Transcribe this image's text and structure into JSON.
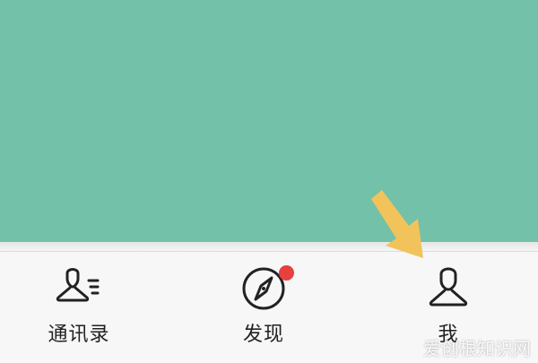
{
  "content": {
    "background_color": "#73c1a9"
  },
  "tabbar": {
    "tabs": [
      {
        "label": "通讯录",
        "icon": "contacts-icon"
      },
      {
        "label": "发现",
        "icon": "compass-icon",
        "has_badge": true,
        "badge_color": "#e8403f"
      },
      {
        "label": "我",
        "icon": "person-icon"
      }
    ]
  },
  "annotation": {
    "arrow_color": "#f2c35a",
    "points_to": "我"
  },
  "watermark": {
    "text": "爱创根知识网"
  }
}
